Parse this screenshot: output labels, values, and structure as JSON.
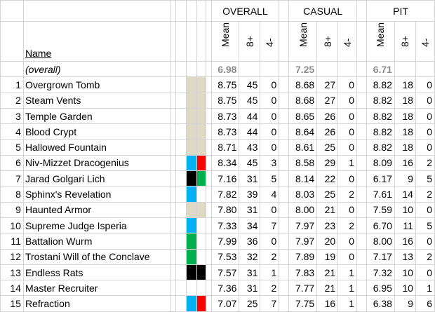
{
  "headers": {
    "name": "Name",
    "groups": [
      "OVERALL",
      "CASUAL",
      "PIT"
    ],
    "sub": [
      "Mean",
      "8+",
      "4-"
    ]
  },
  "overall_row": {
    "label": "(overall)",
    "overall": "6.98",
    "casual": "7.25",
    "pit": "6.71"
  },
  "colors": {
    "land": "#ddd9c4",
    "blue": "#00b0f0",
    "red": "#ff0000",
    "black": "#000000",
    "green": "#00b050",
    "white": "#ffffff"
  },
  "rows": [
    {
      "n": "1",
      "name": "Overgrown Tomb",
      "c1": "land",
      "c2": "land",
      "vals": [
        "8.75",
        "45",
        "0",
        "8.68",
        "27",
        "0",
        "8.82",
        "18",
        "0"
      ]
    },
    {
      "n": "2",
      "name": "Steam Vents",
      "c1": "land",
      "c2": "land",
      "vals": [
        "8.75",
        "45",
        "0",
        "8.68",
        "27",
        "0",
        "8.82",
        "18",
        "0"
      ]
    },
    {
      "n": "3",
      "name": "Temple Garden",
      "c1": "land",
      "c2": "land",
      "vals": [
        "8.73",
        "44",
        "0",
        "8.65",
        "26",
        "0",
        "8.82",
        "18",
        "0"
      ]
    },
    {
      "n": "4",
      "name": "Blood Crypt",
      "c1": "land",
      "c2": "land",
      "vals": [
        "8.73",
        "44",
        "0",
        "8.64",
        "26",
        "0",
        "8.82",
        "18",
        "0"
      ]
    },
    {
      "n": "5",
      "name": "Hallowed Fountain",
      "c1": "land",
      "c2": "land",
      "vals": [
        "8.71",
        "43",
        "0",
        "8.61",
        "25",
        "0",
        "8.82",
        "18",
        "0"
      ]
    },
    {
      "n": "6",
      "name": "Niv-Mizzet Dracogenius",
      "c1": "blue",
      "c2": "red",
      "vals": [
        "8.34",
        "45",
        "3",
        "8.58",
        "29",
        "1",
        "8.09",
        "16",
        "2"
      ]
    },
    {
      "n": "7",
      "name": "Jarad Golgari Lich",
      "c1": "black",
      "c2": "green",
      "vals": [
        "7.16",
        "31",
        "5",
        "8.14",
        "22",
        "0",
        "6.17",
        "9",
        "5"
      ]
    },
    {
      "n": "8",
      "name": "Sphinx's Revelation",
      "c1": "blue",
      "c2": "white",
      "vals": [
        "7.82",
        "39",
        "4",
        "8.03",
        "25",
        "2",
        "7.61",
        "14",
        "2"
      ]
    },
    {
      "n": "9",
      "name": "Haunted Armor",
      "c1": "land",
      "c2": "land",
      "vals": [
        "7.80",
        "31",
        "0",
        "8.00",
        "21",
        "0",
        "7.59",
        "10",
        "0"
      ]
    },
    {
      "n": "10",
      "name": "Supreme Judge Isperia",
      "c1": "blue",
      "c2": "white",
      "vals": [
        "7.33",
        "34",
        "7",
        "7.97",
        "23",
        "2",
        "6.70",
        "11",
        "5"
      ]
    },
    {
      "n": "11",
      "name": "Battalion Wurm",
      "c1": "green",
      "c2": "white",
      "vals": [
        "7.99",
        "36",
        "0",
        "7.97",
        "20",
        "0",
        "8.00",
        "16",
        "0"
      ]
    },
    {
      "n": "12",
      "name": "Trostani Will of the Conclave",
      "c1": "green",
      "c2": "white",
      "vals": [
        "7.53",
        "32",
        "2",
        "7.89",
        "19",
        "0",
        "7.17",
        "13",
        "2"
      ]
    },
    {
      "n": "13",
      "name": "Endless Rats",
      "c1": "black",
      "c2": "black",
      "vals": [
        "7.57",
        "31",
        "1",
        "7.83",
        "21",
        "1",
        "7.32",
        "10",
        "0"
      ]
    },
    {
      "n": "14",
      "name": "Master Recruiter",
      "c1": "white",
      "c2": "white",
      "vals": [
        "7.36",
        "31",
        "2",
        "7.77",
        "21",
        "1",
        "6.95",
        "10",
        "1"
      ]
    },
    {
      "n": "15",
      "name": "Refraction",
      "c1": "blue",
      "c2": "red",
      "vals": [
        "7.07",
        "25",
        "7",
        "7.75",
        "16",
        "1",
        "6.38",
        "9",
        "6"
      ]
    }
  ]
}
